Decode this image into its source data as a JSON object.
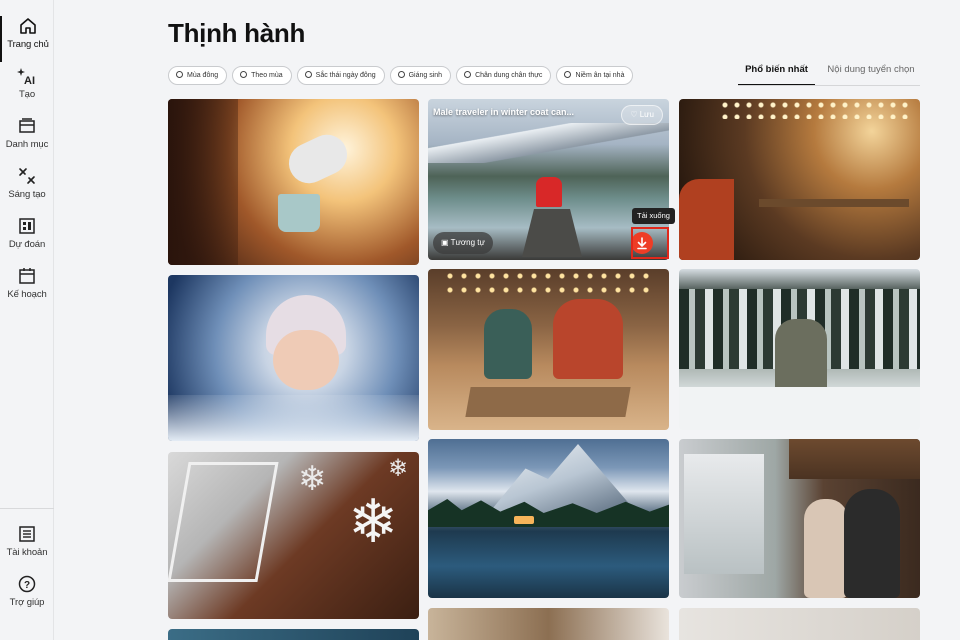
{
  "sidebar": {
    "items": [
      {
        "label": "Trang chủ",
        "icon": "home-icon",
        "active": true
      },
      {
        "label": "Tạo",
        "icon": "ai-sparkle-icon"
      },
      {
        "label": "Danh mục",
        "icon": "catalog-icon"
      },
      {
        "label": "Sáng tạo",
        "icon": "creative-icon"
      },
      {
        "label": "Dự đoán",
        "icon": "predict-icon"
      },
      {
        "label": "Kế hoạch",
        "icon": "calendar-icon"
      }
    ],
    "bottom": [
      {
        "label": "Tài khoản",
        "icon": "account-icon"
      },
      {
        "label": "Trợ giúp",
        "icon": "help-icon"
      }
    ]
  },
  "page": {
    "title": "Thịnh hành"
  },
  "chips": [
    "Mùa đông",
    "Theo mùa",
    "Sắc thái ngày đông",
    "Giáng sinh",
    "Chân dung chân thực",
    "Niềm ân tại nhà"
  ],
  "tabs": [
    "Phổ biến nhất",
    "Nội dung tuyển chọn"
  ],
  "hovered": {
    "title": "Male traveler in winter coat can...",
    "save_label": "Lưu",
    "similar_label": "Tương tự",
    "download_tooltip": "Tải xuống"
  },
  "colors": {
    "accent": "#ee3d26",
    "text": "#111111"
  }
}
